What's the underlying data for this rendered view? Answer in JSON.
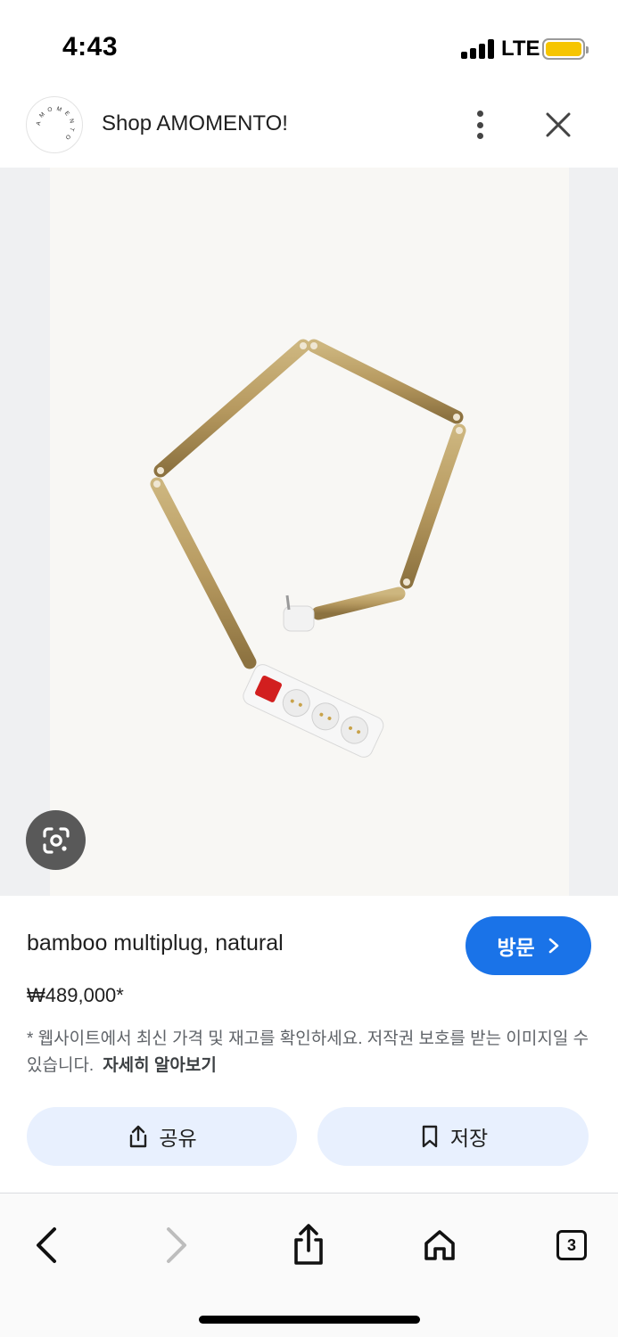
{
  "status_bar": {
    "time": "4:43",
    "network": "LTE",
    "battery_color": "#f6c500"
  },
  "header": {
    "site_name": "Shop AMOMENTO!",
    "logo_text": "AMOMENTO",
    "more_icon": "more-vert-icon",
    "close_icon": "close-icon"
  },
  "image": {
    "lens_icon": "google-lens-icon",
    "bamboo_color": "#b79a60",
    "switch_color": "#d21f1f"
  },
  "product": {
    "title": "bamboo multiplug, natural",
    "price": "₩489,000*",
    "visit_label": "방문",
    "disclaimer": "* 웹사이트에서 최신 가격 및 재고를 확인하세요. 저작권 보호를 받는 이미지일 수 있습니다.",
    "learn_more": "자세히 알아보기",
    "accent_color": "#1a73e8"
  },
  "actions": {
    "share_label": "공유",
    "save_label": "저장"
  },
  "toolbar": {
    "tabs_count": "3"
  }
}
